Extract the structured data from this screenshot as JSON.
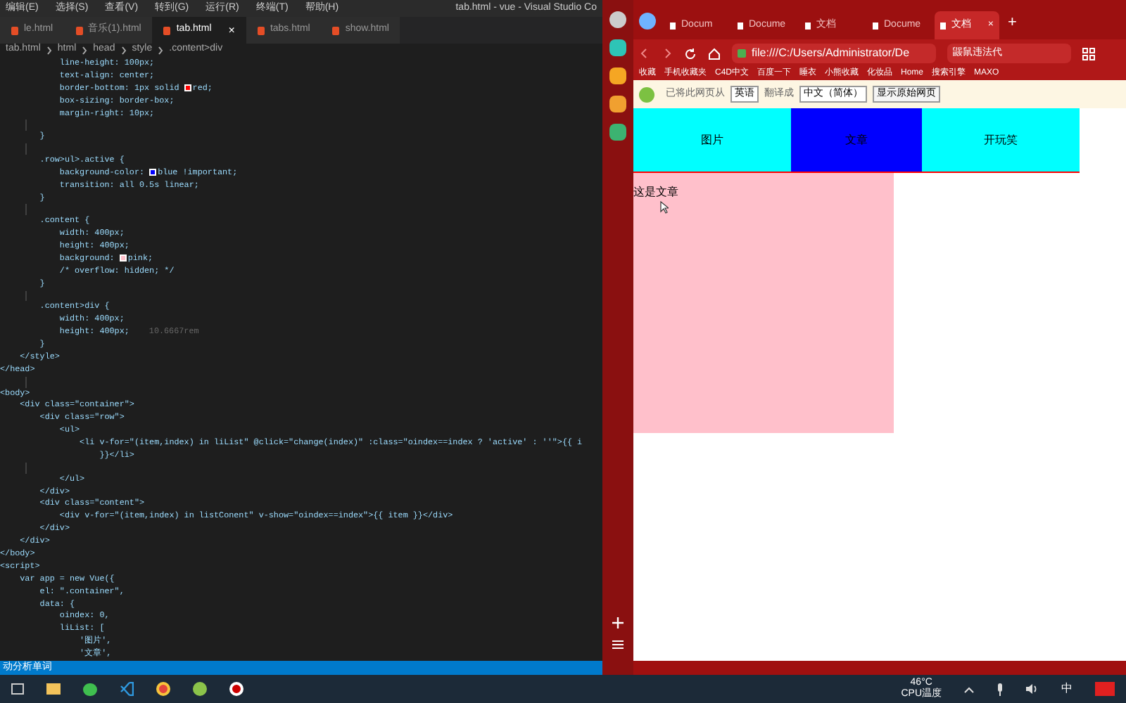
{
  "editor": {
    "menu": [
      "编辑(E)",
      "选择(S)",
      "查看(V)",
      "转到(G)",
      "运行(R)",
      "终端(T)",
      "帮助(H)"
    ],
    "window_title": "tab.html - vue - Visual Studio Co",
    "tabs": [
      {
        "label": "le.html",
        "selected": false
      },
      {
        "label": "音乐(1).html",
        "selected": false
      },
      {
        "label": "tab.html",
        "selected": true,
        "close": "×"
      },
      {
        "label": "tabs.html",
        "selected": false
      },
      {
        "label": "show.html",
        "selected": false
      }
    ],
    "breadcrumb": [
      "tab.html",
      "html",
      "head",
      "style",
      ".content>div"
    ],
    "code_lines": [
      {
        "text": "            line-height: 100px;"
      },
      {
        "text": "            text-align: center;"
      },
      {
        "text": "            border-bottom: 1px solid ",
        "color": "#ff0000",
        "after": "red;"
      },
      {
        "text": "            box-sizing: border-box;"
      },
      {
        "text": "            margin-right: 10px;"
      },
      {
        "kind": "blank"
      },
      {
        "text": "        }"
      },
      {
        "kind": "blank"
      },
      {
        "text": "        .row>ul>.active {"
      },
      {
        "text": "            background-color: ",
        "color": "#0000ff",
        "after": "blue !important;"
      },
      {
        "text": "            transition: all 0.5s linear;"
      },
      {
        "text": "        }"
      },
      {
        "kind": "blank"
      },
      {
        "text": "        .content {"
      },
      {
        "text": "            width: 400px;"
      },
      {
        "text": "            height: 400px;"
      },
      {
        "text": "            background: ",
        "color": "#ffc0cb",
        "after": "pink;"
      },
      {
        "text": "            /* overflow: hidden; */"
      },
      {
        "text": "        }"
      },
      {
        "kind": "blank"
      },
      {
        "text": "        .content>div {"
      },
      {
        "text": "            width: 400px;"
      },
      {
        "text": "            height: 400px;",
        "hint": "10.6667rem"
      },
      {
        "text": "        }"
      },
      {
        "text": "    </style>"
      },
      {
        "text": "</head>"
      },
      {
        "kind": "blank"
      },
      {
        "text": "<body>"
      },
      {
        "text": "    <div class=\"container\">"
      },
      {
        "text": "        <div class=\"row\">"
      },
      {
        "text": "            <ul>"
      },
      {
        "text": "                <li v-for=\"(item,index) in liList\" @click=\"change(index)\" :class=\"oindex==index ? 'active' : ''\">{{ i"
      },
      {
        "text": "                    }}</li>"
      },
      {
        "kind": "blank"
      },
      {
        "text": "            </ul>"
      },
      {
        "text": "        </div>"
      },
      {
        "text": "        <div class=\"content\">"
      },
      {
        "text": "            <div v-for=\"(item,index) in listConent\" v-show=\"oindex==index\">{{ item }}</div>"
      },
      {
        "text": "        </div>"
      },
      {
        "text": "    </div>"
      },
      {
        "text": "</body>"
      },
      {
        "text": "<script>"
      },
      {
        "text": "    var app = new Vue({"
      },
      {
        "text": "        el: \".container\","
      },
      {
        "text": "        data: {"
      },
      {
        "text": "            oindex: 0,"
      },
      {
        "text": "            liList: ["
      },
      {
        "text": "                '图片',"
      },
      {
        "text": "                '文章',"
      }
    ],
    "status_bar": "动分析单词"
  },
  "browser": {
    "tabs": [
      {
        "label": "Docum",
        "selected": false
      },
      {
        "label": "Docume",
        "selected": false
      },
      {
        "label": "文档",
        "selected": false
      },
      {
        "label": "Docume",
        "selected": false
      },
      {
        "label": "文档",
        "selected": true,
        "close": "×"
      }
    ],
    "new_tab": "+",
    "address": "file:///C:/Users/Administrator/De",
    "search": "鼹鼠违法代",
    "bookmarks": [
      "收藏",
      "手机收藏夹",
      "C4D中文",
      "百度一下",
      "睡衣",
      "小熊收藏",
      "化妆品",
      "Home",
      "搜索引擎",
      "MAXO"
    ],
    "translate": {
      "prefix": "已将此网页从",
      "from": "英语",
      "middle": "翻译成",
      "to": "中文（简体）",
      "show_original": "显示原始网页"
    },
    "page": {
      "tabs": [
        {
          "label": "图片",
          "selected": false
        },
        {
          "label": "文章",
          "selected": true
        },
        {
          "label": "开玩笑",
          "selected": false
        }
      ],
      "content": "这是文章"
    }
  },
  "taskbar": {
    "temperature": "46°C",
    "temperature_label": "CPU温度",
    "ime": "中"
  }
}
